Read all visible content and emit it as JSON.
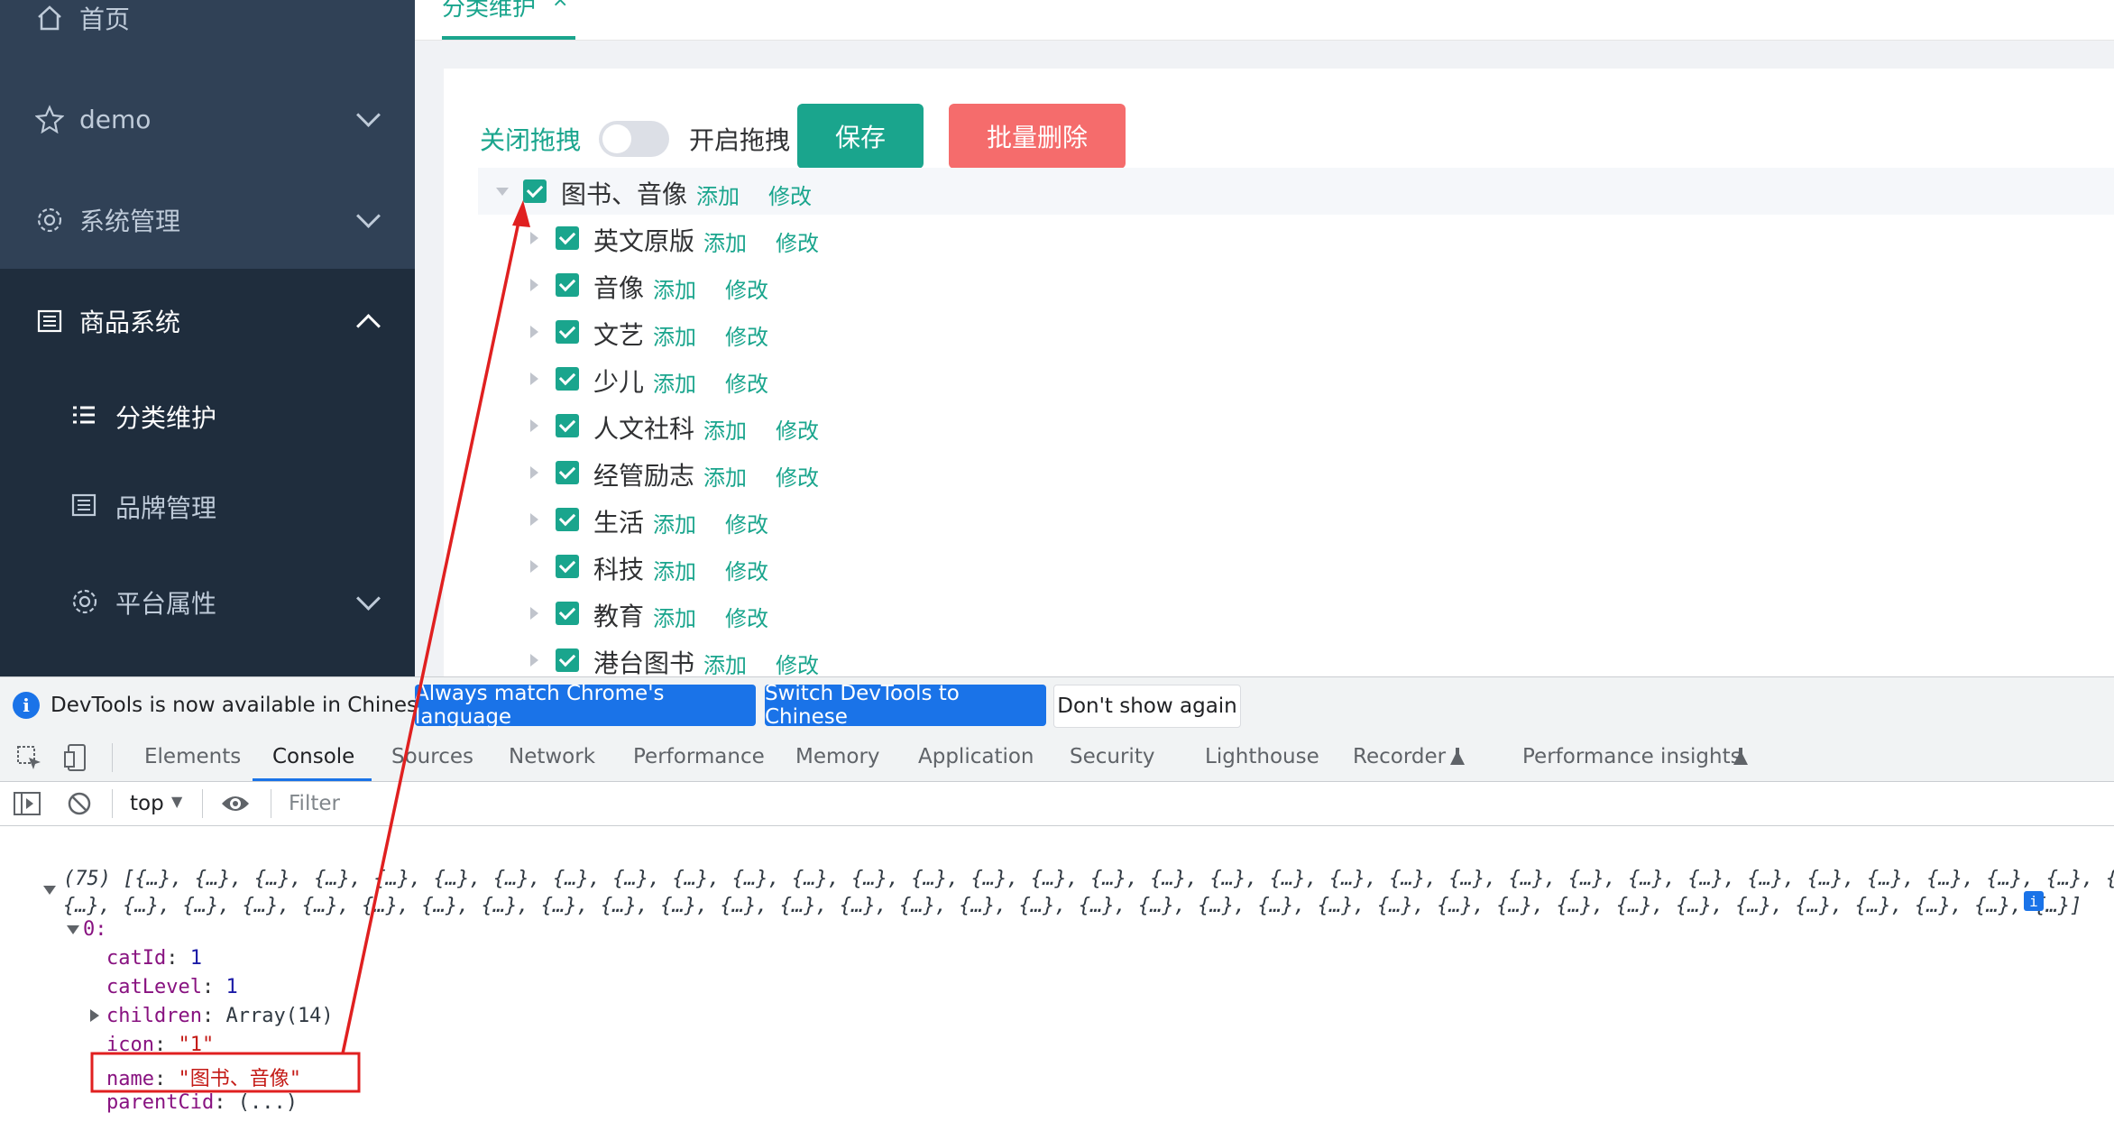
{
  "sidebar": {
    "items": [
      {
        "label": "首页",
        "icon": "home-icon"
      },
      {
        "label": "demo",
        "icon": "star-icon"
      },
      {
        "label": "系统管理",
        "icon": "gear-icon"
      },
      {
        "label": "商品系统",
        "icon": "doc-icon"
      }
    ],
    "sub_items": [
      {
        "label": "分类维护",
        "icon": "list-icon",
        "active": true
      },
      {
        "label": "品牌管理",
        "icon": "doc-icon"
      },
      {
        "label": "平台属性",
        "icon": "gear-icon"
      }
    ]
  },
  "tabs": [
    {
      "label": "分类维护",
      "close": "×"
    }
  ],
  "controls": {
    "drag_off_label": "关闭拖拽",
    "drag_on_label": "开启拖拽",
    "save_label": "保存",
    "batch_delete_label": "批量删除"
  },
  "tree": {
    "root": {
      "label": "图书、音像",
      "add": "添加",
      "edit": "修改"
    },
    "children": [
      {
        "label": "英文原版",
        "add": "添加",
        "edit": "修改"
      },
      {
        "label": "音像",
        "add": "添加",
        "edit": "修改"
      },
      {
        "label": "文艺",
        "add": "添加",
        "edit": "修改"
      },
      {
        "label": "少儿",
        "add": "添加",
        "edit": "修改"
      },
      {
        "label": "人文社科",
        "add": "添加",
        "edit": "修改"
      },
      {
        "label": "经管励志",
        "add": "添加",
        "edit": "修改"
      },
      {
        "label": "生活",
        "add": "添加",
        "edit": "修改"
      },
      {
        "label": "科技",
        "add": "添加",
        "edit": "修改"
      },
      {
        "label": "教育",
        "add": "添加",
        "edit": "修改"
      },
      {
        "label": "港台图书",
        "add": "添加",
        "edit": "修改"
      }
    ]
  },
  "devtools": {
    "notice": "DevTools is now available in Chinese!",
    "btn_match": "Always match Chrome's language",
    "btn_switch": "Switch DevTools to Chinese",
    "btn_dismiss": "Don't show again",
    "tabs": [
      "Elements",
      "Console",
      "Sources",
      "Network",
      "Performance",
      "Memory",
      "Application",
      "Security",
      "Lighthouse",
      "Recorder",
      "Performance insights"
    ],
    "active_tab": "Console",
    "context": "top",
    "filter_placeholder": "Filter"
  },
  "console": {
    "line1": "(75) [{…}, {…}, {…}, {…}, {…}, {…}, {…}, {…}, {…}, {…}, {…}, {…}, {…}, {…}, {…}, {…}, {…}, {…}, {…}, {…}, {…}, {…}, {…}, {…}, {…}, {…}, {…}, {…}, {…}, {…}, {…}, {…}, {…}, {…}",
    "line2": "{…}, {…}, {…}, {…}, {…}, {…}, {…}, {…}, {…}, {…}, {…}, {…}, {…}, {…}, {…}, {…}, {…}, {…}, {…}, {…}, {…}, {…}, {…}, {…}, {…}, {…}, {…}, {…}, {…}, {…}, {…}, {…}, {…}, {…}]",
    "index": "0:",
    "props": [
      {
        "key": "catId",
        "val": "1",
        "type": "num"
      },
      {
        "key": "catLevel",
        "val": "1",
        "type": "num"
      },
      {
        "key": "children",
        "val": "Array(14)",
        "type": "obj"
      },
      {
        "key": "icon",
        "val": "\"1\"",
        "type": "str"
      },
      {
        "key": "name",
        "val": "\"图书、音像\"",
        "type": "str"
      },
      {
        "key": "parentCid",
        "val": "(...)",
        "type": "obj"
      }
    ]
  },
  "colors": {
    "accent": "#1aa58d",
    "danger": "#f56c6c",
    "annotation": "#e02020",
    "sidebar": "#304156"
  }
}
